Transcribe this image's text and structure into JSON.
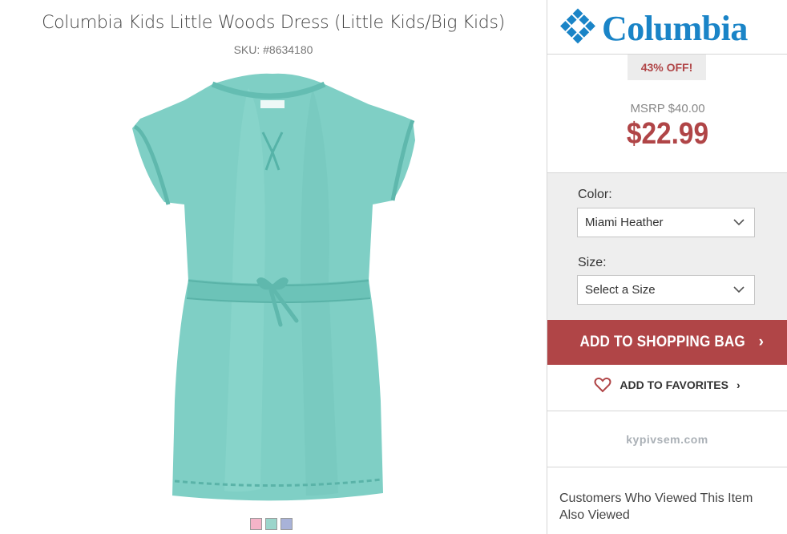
{
  "product": {
    "title": "Columbia Kids Little Woods Dress (Little Kids/Big Kids)",
    "sku": "SKU: #8634180",
    "image_icon": "teal-dress-image",
    "swatches": [
      {
        "color": "#f4b4c8"
      },
      {
        "color": "#9bd5cb"
      },
      {
        "color": "#a8b2d8"
      }
    ]
  },
  "brand": {
    "name": "Columbia",
    "color": "#1a84c7"
  },
  "pricing": {
    "discount": "43% OFF!",
    "msrp": "MSRP $40.00",
    "price": "$22.99",
    "accent": "#b04547"
  },
  "options": {
    "color_label": "Color:",
    "color_value": "Miami Heather",
    "size_label": "Size:",
    "size_value": "Select a Size"
  },
  "actions": {
    "add_to_bag": "ADD TO SHOPPING BAG",
    "add_to_bag_arrow": "›",
    "favorites": "ADD TO FAVORITES",
    "favorites_arrow": "›"
  },
  "watermark": "kypivsem.com",
  "recommendations": {
    "heading": "Customers Who Viewed This Item Also Viewed"
  }
}
